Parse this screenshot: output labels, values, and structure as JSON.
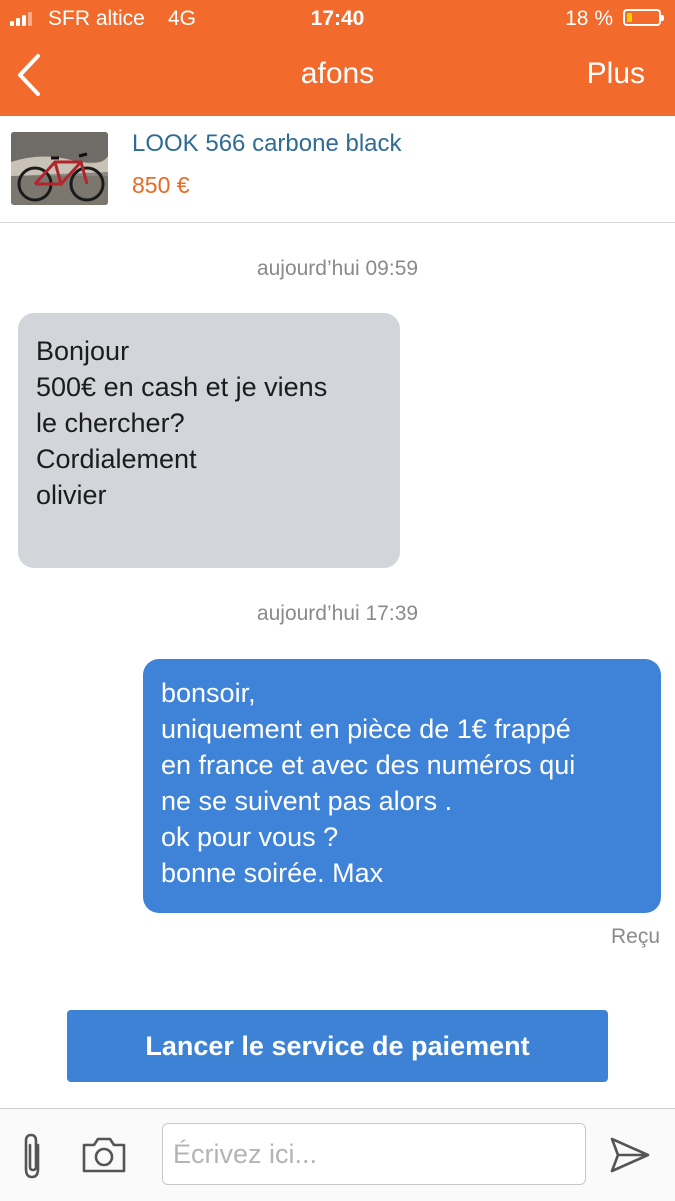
{
  "status_bar": {
    "carrier": "SFR altice",
    "network": "4G",
    "time": "17:40",
    "battery_text": "18 %",
    "battery_level": 0.18
  },
  "nav": {
    "back_icon": "chevron-left-icon",
    "title": "afons",
    "more_label": "Plus"
  },
  "listing": {
    "title": "LOOK 566 carbone black",
    "price": "850 €"
  },
  "messages": [
    {
      "timestamp": "aujourd’hui 09:59",
      "direction": "incoming",
      "text": "Bonjour\n500€ en cash et je viens\nle chercher?\nCordialement\nolivier"
    },
    {
      "timestamp": "aujourd’hui 17:39",
      "direction": "outgoing",
      "text": "bonsoir,\nuniquement en pièce de 1€ frappé\nen france et avec des numéros qui\nne se suivent pas alors .\nok pour vous ?\nbonne soirée. Max",
      "receipt": "Reçu"
    }
  ],
  "payment_button": {
    "label": "Lancer le service de paiement"
  },
  "composer": {
    "attach_icon": "paperclip-icon",
    "camera_icon": "camera-icon",
    "placeholder": "Écrivez ici...",
    "value": "",
    "send_icon": "send-icon"
  },
  "colors": {
    "brand": "#f26b2c",
    "link_blue": "#2f6c95",
    "price_orange": "#ea6a23",
    "incoming_bubble": "#d2d5da",
    "outgoing_bubble": "#3f83d8",
    "button_blue": "#3e82d6"
  }
}
